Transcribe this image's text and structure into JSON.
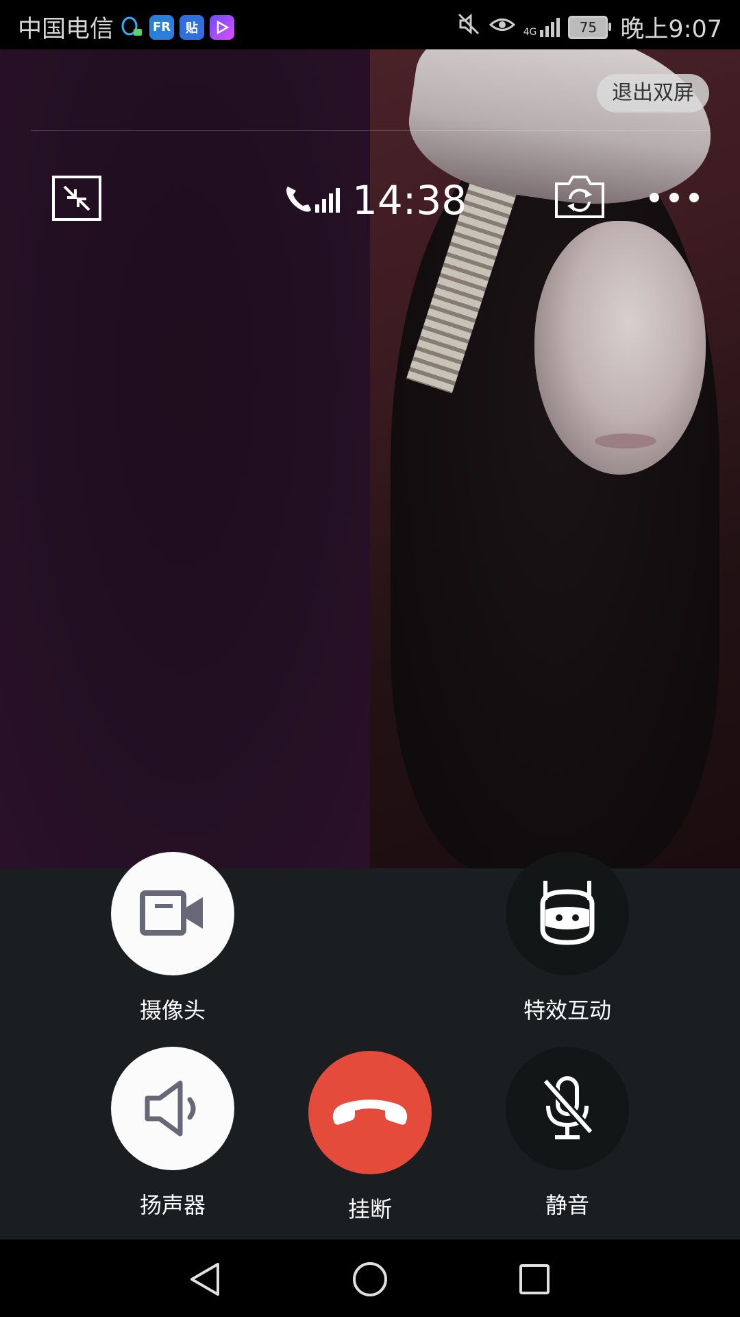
{
  "status_bar": {
    "carrier": "中国电信",
    "app_icons": [
      "qq-icon",
      "fr-icon",
      "tieba-icon",
      "video-app-icon"
    ],
    "icons": [
      "mute-icon",
      "eye-icon",
      "4g-signal-icon",
      "battery-icon"
    ],
    "network": "4G",
    "battery": "75",
    "time": "晚上9:07"
  },
  "video": {
    "exit_dual_label": "退出双屏",
    "call_duration": "14:38"
  },
  "controls": {
    "camera_label": "摄像头",
    "effects_label": "特效互动",
    "speaker_label": "扬声器",
    "hangup_label": "挂断",
    "mute_label": "静音"
  },
  "colors": {
    "hangup": "#e44b3a",
    "panel_bg": "#1b1e20",
    "button_light": "#fbfbfb",
    "button_dark": "#131617",
    "icon_gray": "#666777"
  }
}
